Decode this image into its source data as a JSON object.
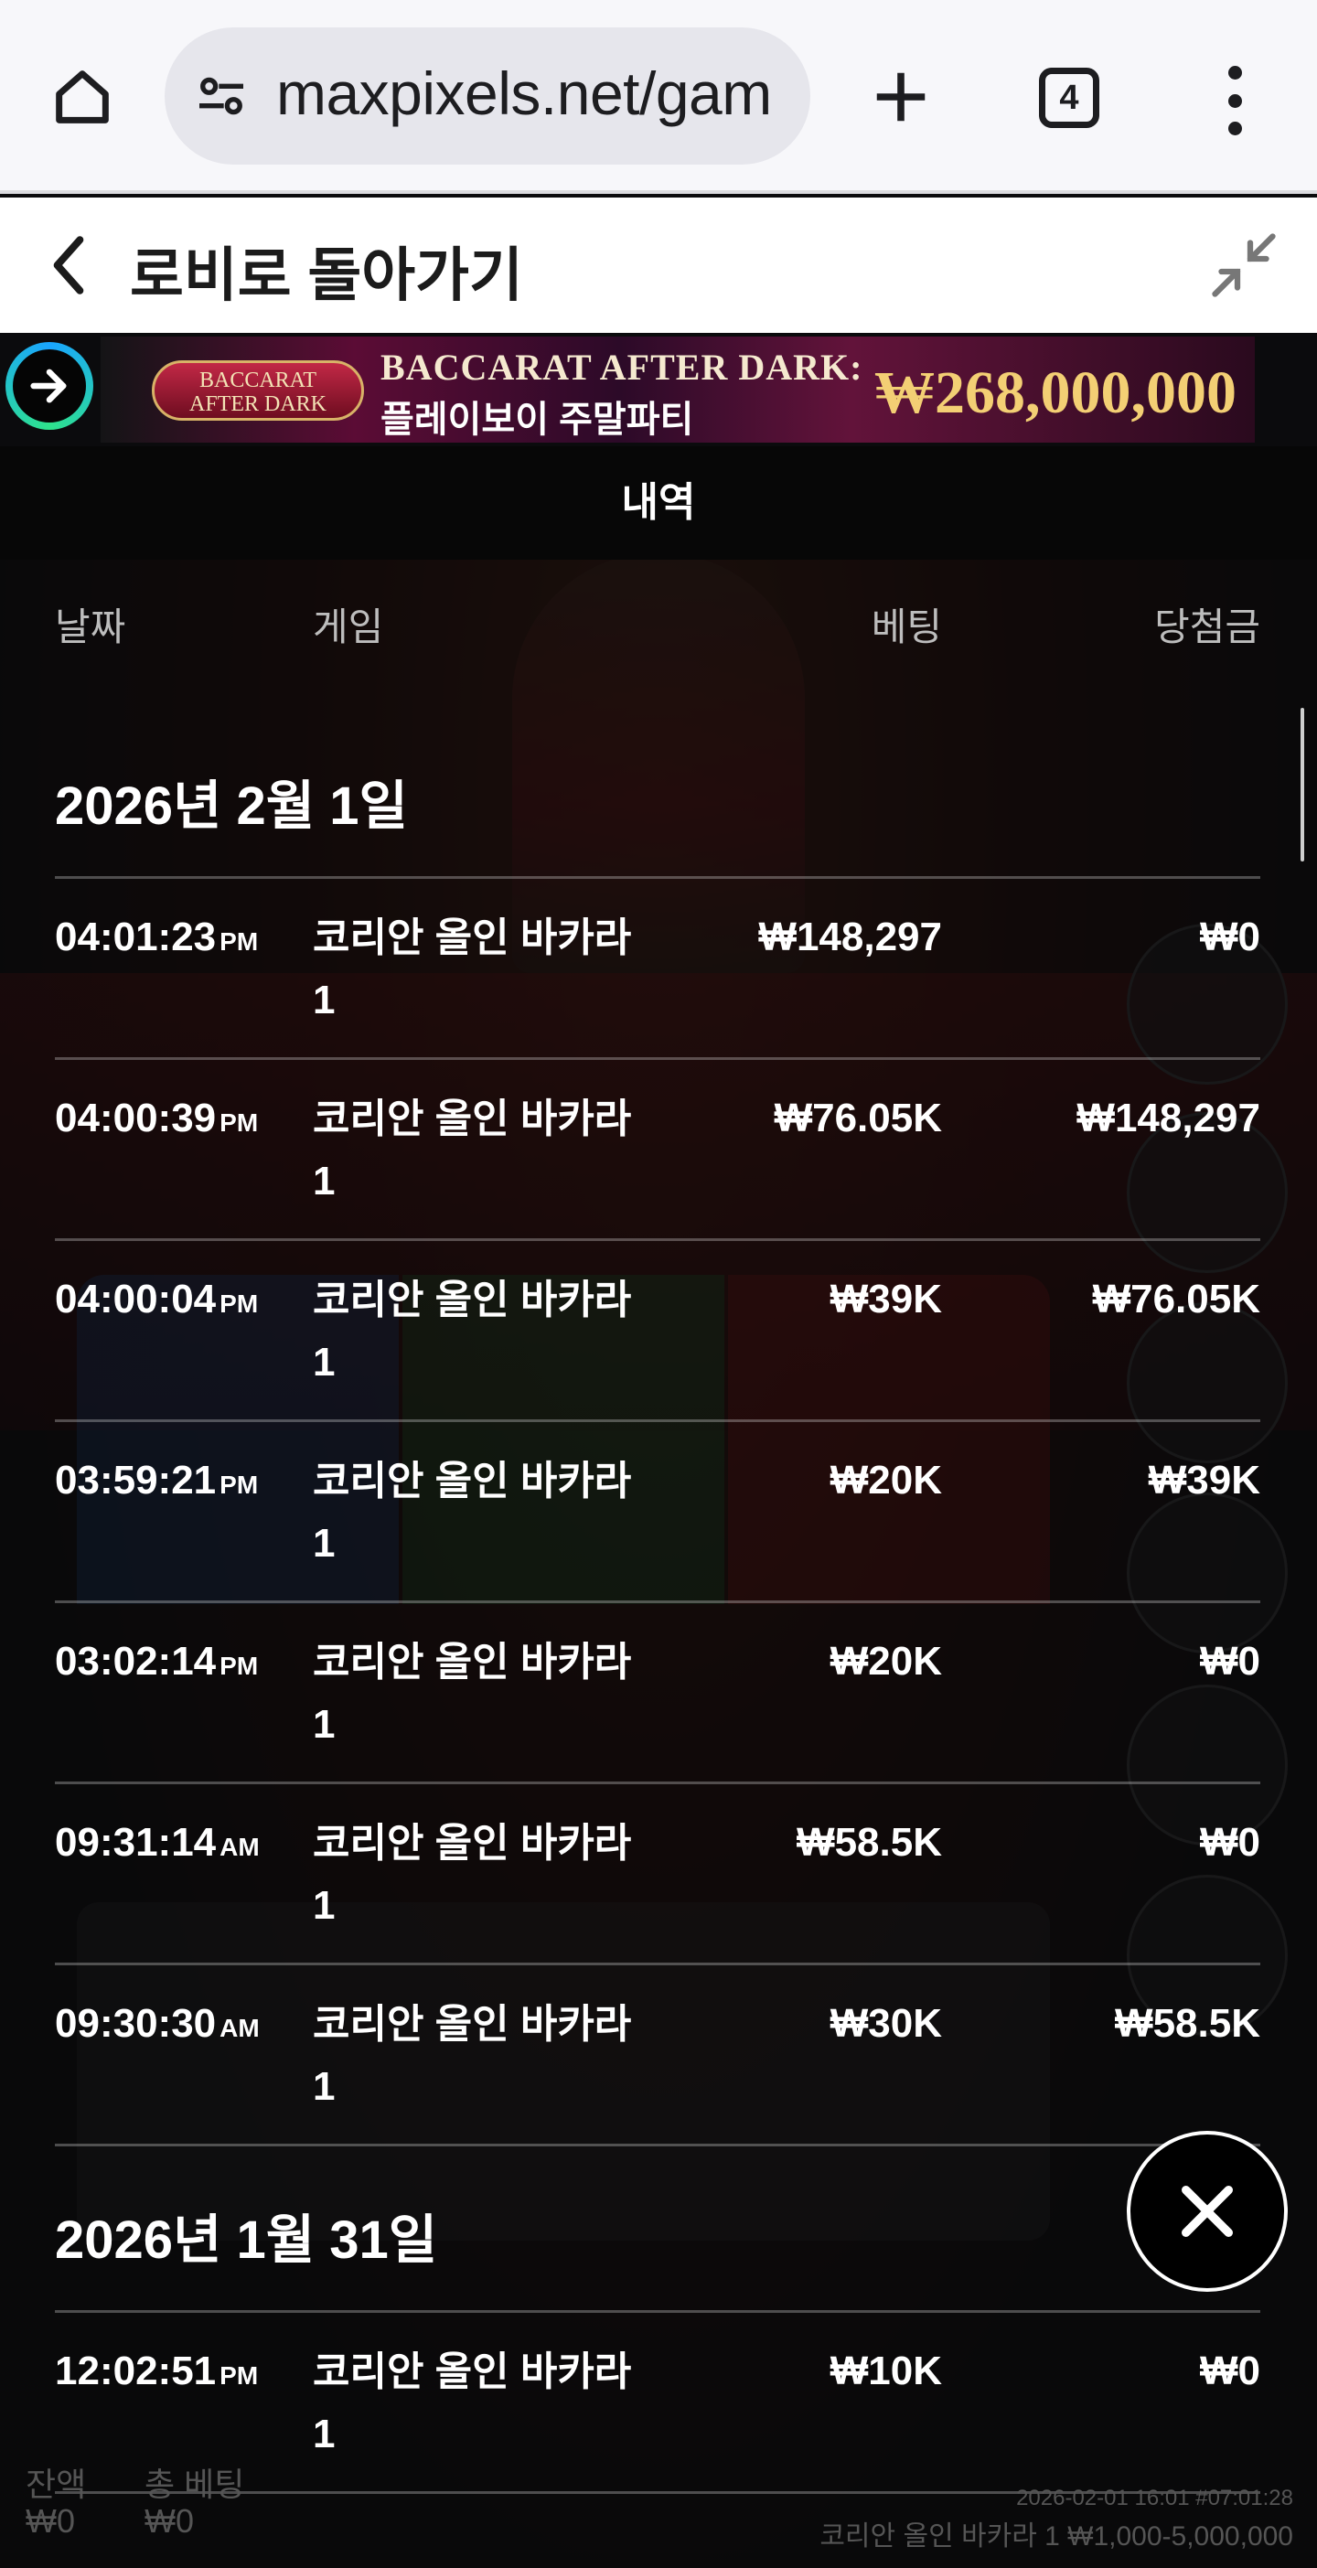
{
  "browser": {
    "url": "maxpixels.net/gam",
    "tab_count": "4",
    "icons": [
      "home-icon",
      "site-settings-icon",
      "plus-icon",
      "tabs-icon",
      "more-vert-icon"
    ]
  },
  "game_header": {
    "back_label": "로비로 돌아가기",
    "icons": [
      "chevron-left-icon",
      "minimize-icon"
    ]
  },
  "promo": {
    "logo_line1": "BACCARAT",
    "logo_line2": "AFTER DARK",
    "title": "BACCARAT AFTER DARK:",
    "subtitle": "플레이보이 주말파티",
    "amount": "₩268,000,000"
  },
  "history": {
    "title": "내역",
    "columns": {
      "date": "날짜",
      "game": "게임",
      "bet": "베팅",
      "win": "당첨금"
    },
    "groups": [
      {
        "date": "2026년 2월 1일",
        "rows": [
          {
            "time": "04:01:23",
            "ampm": "PM",
            "game": "코리안 올인 바카라 1",
            "bet": "₩148,297",
            "win": "₩0"
          },
          {
            "time": "04:00:39",
            "ampm": "PM",
            "game": "코리안 올인 바카라 1",
            "bet": "₩76.05K",
            "win": "₩148,297"
          },
          {
            "time": "04:00:04",
            "ampm": "PM",
            "game": "코리안 올인 바카라 1",
            "bet": "₩39K",
            "win": "₩76.05K"
          },
          {
            "time": "03:59:21",
            "ampm": "PM",
            "game": "코리안 올인 바카라 1",
            "bet": "₩20K",
            "win": "₩39K"
          },
          {
            "time": "03:02:14",
            "ampm": "PM",
            "game": "코리안 올인 바카라 1",
            "bet": "₩20K",
            "win": "₩0"
          },
          {
            "time": "09:31:14",
            "ampm": "AM",
            "game": "코리안 올인 바카라 1",
            "bet": "₩58.5K",
            "win": "₩0"
          },
          {
            "time": "09:30:30",
            "ampm": "AM",
            "game": "코리안 올인 바카라 1",
            "bet": "₩30K",
            "win": "₩58.5K"
          }
        ]
      },
      {
        "date": "2026년 1월 31일",
        "rows": [
          {
            "time": "12:02:51",
            "ampm": "PM",
            "game": "코리안 올인 바카라 1",
            "bet": "₩10K",
            "win": "₩0"
          }
        ]
      }
    ]
  },
  "footer": {
    "balance_label": "잔액",
    "balance_value": "₩0",
    "total_bet_label": "총 베팅",
    "total_bet_value": "₩0",
    "timestamp": "2026-02-01 16:01 #07:01:28",
    "table_info": "코리안 올인 바카라 1 ₩1,000-5,000,000"
  },
  "colors": {
    "promo_amount": "#f3cf74",
    "overlay_bg": "#070707"
  }
}
